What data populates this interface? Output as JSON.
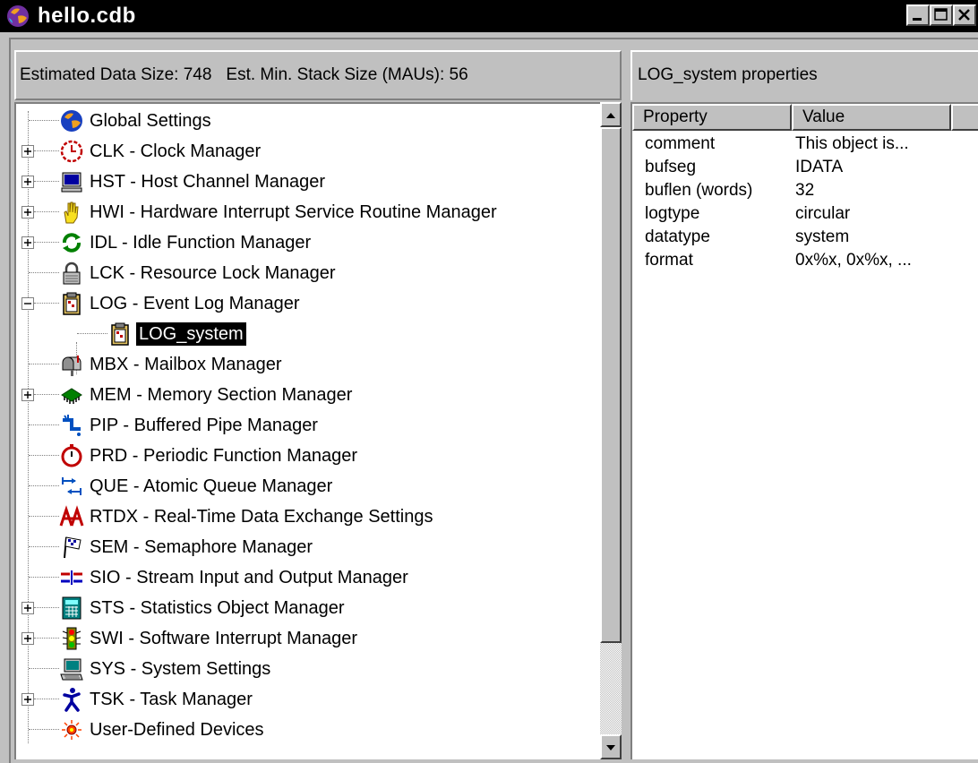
{
  "window": {
    "title": "hello.cdb",
    "buttons": [
      "minimize",
      "maximize",
      "close"
    ]
  },
  "left_header": {
    "data_size": "Estimated Data Size: 748",
    "stack_size": "Est. Min. Stack Size (MAUs): 56"
  },
  "tree": {
    "items": [
      {
        "label": "Global Settings",
        "icon": "globe-icon",
        "expander": "none",
        "level": 0
      },
      {
        "label": "CLK - Clock Manager",
        "icon": "clock-icon",
        "expander": "plus",
        "level": 0
      },
      {
        "label": "HST - Host Channel Manager",
        "icon": "monitor-icon",
        "expander": "plus",
        "level": 0
      },
      {
        "label": "HWI - Hardware Interrupt Service Routine Manager",
        "icon": "hand-icon",
        "expander": "plus",
        "level": 0
      },
      {
        "label": "IDL - Idle Function Manager",
        "icon": "cycle-icon",
        "expander": "plus",
        "level": 0
      },
      {
        "label": "LCK - Resource Lock Manager",
        "icon": "lock-icon",
        "expander": "none",
        "level": 0
      },
      {
        "label": "LOG - Event Log Manager",
        "icon": "log-icon",
        "expander": "minus",
        "level": 0
      },
      {
        "label": "LOG_system",
        "icon": "log-icon",
        "expander": "none",
        "level": 1,
        "selected": true
      },
      {
        "label": "MBX - Mailbox Manager",
        "icon": "mailbox-icon",
        "expander": "none",
        "level": 0
      },
      {
        "label": "MEM - Memory Section Manager",
        "icon": "memory-chip-icon",
        "expander": "plus",
        "level": 0
      },
      {
        "label": "PIP - Buffered Pipe Manager",
        "icon": "pipe-icon",
        "expander": "none",
        "level": 0
      },
      {
        "label": "PRD - Periodic Function Manager",
        "icon": "stopwatch-icon",
        "expander": "none",
        "level": 0
      },
      {
        "label": "QUE - Atomic Queue Manager",
        "icon": "queue-icon",
        "expander": "none",
        "level": 0
      },
      {
        "label": "RTDX - Real-Time Data Exchange Settings",
        "icon": "rtdx-icon",
        "expander": "none",
        "level": 0
      },
      {
        "label": "SEM - Semaphore Manager",
        "icon": "flag-icon",
        "expander": "none",
        "level": 0
      },
      {
        "label": "SIO - Stream Input and Output Manager",
        "icon": "stream-icon",
        "expander": "none",
        "level": 0
      },
      {
        "label": "STS - Statistics Object Manager",
        "icon": "calculator-icon",
        "expander": "plus",
        "level": 0
      },
      {
        "label": "SWI - Software Interrupt Manager",
        "icon": "traffic-light-icon",
        "expander": "plus",
        "level": 0
      },
      {
        "label": "SYS - System Settings",
        "icon": "computer-icon",
        "expander": "none",
        "level": 0
      },
      {
        "label": "TSK - Task Manager",
        "icon": "runner-icon",
        "expander": "plus",
        "level": 0
      },
      {
        "label": "User-Defined Devices",
        "icon": "device-icon",
        "expander": "none",
        "level": 0
      }
    ]
  },
  "right_header": {
    "title": "LOG_system properties"
  },
  "properties": {
    "columns": [
      "Property",
      "Value"
    ],
    "rows": [
      {
        "name": "comment",
        "value": "This object is..."
      },
      {
        "name": "bufseg",
        "value": "IDATA"
      },
      {
        "name": "buflen (words)",
        "value": "32"
      },
      {
        "name": "logtype",
        "value": "circular"
      },
      {
        "name": "datatype",
        "value": "system"
      },
      {
        "name": "format",
        "value": "0x%x, 0x%x, ..."
      }
    ]
  },
  "colors": {
    "titlebar": "#000000",
    "face": "#c0c0c0",
    "selection": "#000000"
  }
}
